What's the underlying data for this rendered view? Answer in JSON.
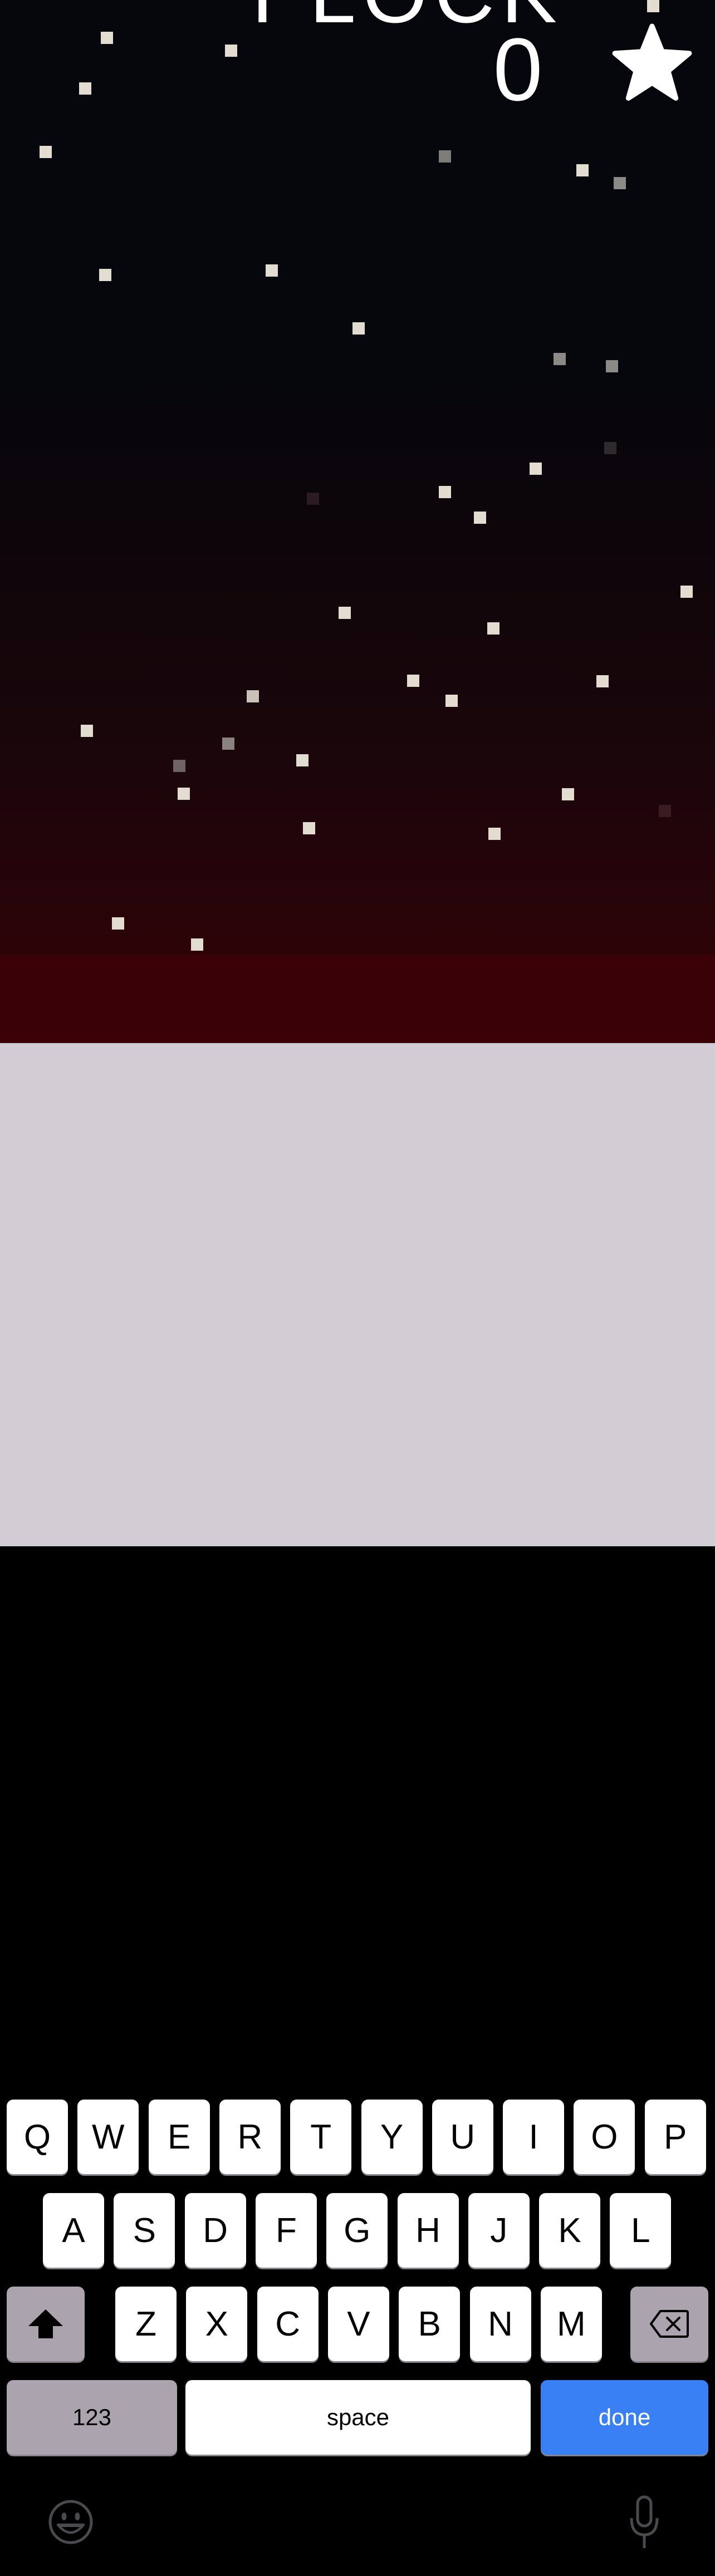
{
  "game": {
    "title": "FLOCK",
    "score": "0"
  },
  "keyboard": {
    "row1": [
      "Q",
      "W",
      "E",
      "R",
      "T",
      "Y",
      "U",
      "I",
      "O",
      "P"
    ],
    "row2": [
      "A",
      "S",
      "D",
      "F",
      "G",
      "H",
      "J",
      "K",
      "L"
    ],
    "row3": [
      "Z",
      "X",
      "C",
      "V",
      "B",
      "N",
      "M"
    ],
    "numbers_label": "123",
    "space_label": "space",
    "done_label": "done",
    "accent_color": "#3a80f5"
  },
  "icons": {
    "star": "star-icon",
    "shift": "shift-icon",
    "delete": "delete-icon",
    "emoji": "emoji-icon",
    "mic": "microphone-icon"
  }
}
